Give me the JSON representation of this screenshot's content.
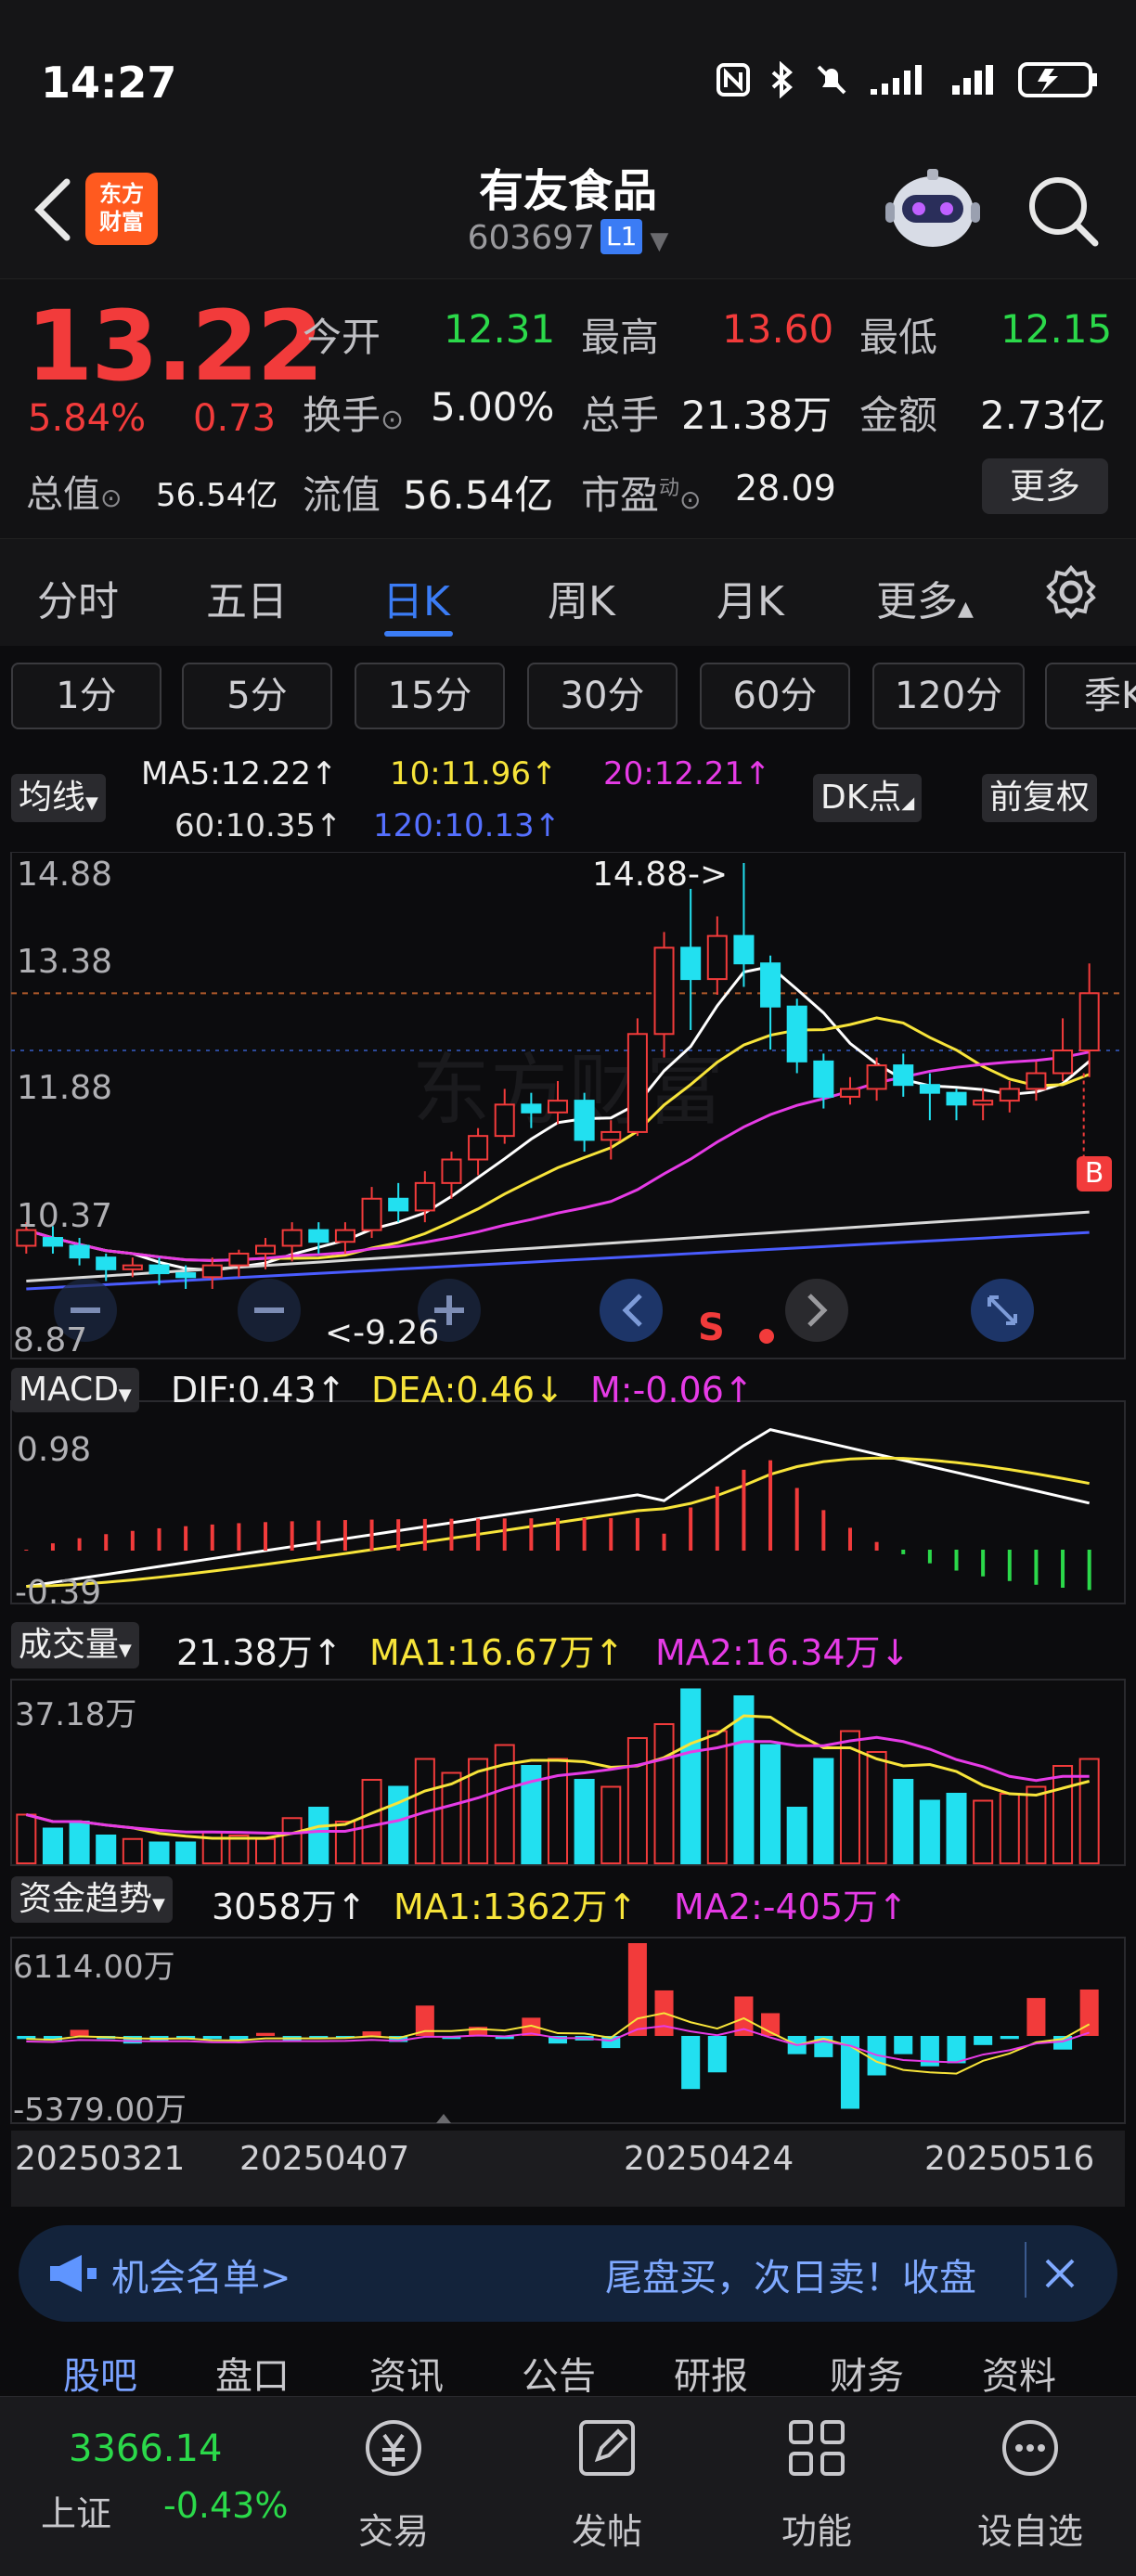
{
  "status": {
    "time": "14:27"
  },
  "header": {
    "name": "有友食品",
    "code": "603697",
    "badge": "L1",
    "logo_line1": "东方",
    "logo_line2": "财富"
  },
  "quote": {
    "price": "13.22",
    "pct": "5.84%",
    "chg": "0.73",
    "open_label": "今开",
    "open": "12.31",
    "high_label": "最高",
    "high": "13.60",
    "low_label": "最低",
    "low": "12.15",
    "turnover_label": "换手",
    "turnover": "5.00%",
    "volume_label": "总手",
    "volume": "21.38万",
    "amount_label": "金额",
    "amount": "2.73亿",
    "total_mv_label": "总值",
    "total_mv": "56.54亿",
    "float_mv_label": "流值",
    "float_mv": "56.54亿",
    "pe_label": "市盈",
    "pe_sup": "动",
    "pe": "28.09",
    "more": "更多"
  },
  "period_tabs": [
    "分时",
    "五日",
    "日K",
    "周K",
    "月K",
    "更多"
  ],
  "minute_buttons": [
    "1分",
    "5分",
    "15分",
    "30分",
    "60分",
    "120分",
    "季K"
  ],
  "ma_legend": {
    "selector": "均线",
    "ma5": "MA5:12.22↑",
    "ma10": "10:11.96↑",
    "ma20": "20:12.21↑",
    "ma60": "60:10.35↑",
    "ma120": "120:10.13↑",
    "dk": "DK点",
    "adjust": "前复权"
  },
  "kline_labels": {
    "y1": "14.88",
    "y2": "13.38",
    "y3": "11.88",
    "y4": "10.37",
    "y5": "8.87",
    "high_note": "14.88->",
    "low_note": "<-9.26",
    "sell_mark": "S",
    "buy_mark": "B"
  },
  "macd": {
    "selector": "MACD",
    "dif": "DIF:0.43↑",
    "dea": "DEA:0.46↓",
    "m": "M:-0.06↑",
    "y_top": "0.98",
    "y_bottom": "-0.39"
  },
  "vol": {
    "selector": "成交量",
    "value": "21.38万↑",
    "ma1": "MA1:16.67万↑",
    "ma2": "MA2:16.34万↓",
    "y_top": "37.18万"
  },
  "fund": {
    "selector": "资金趋势",
    "value": "3058万↑",
    "ma1": "MA1:1362万↑",
    "ma2": "MA2:-405万↑",
    "y_top": "6114.00万",
    "y_bottom": "-5379.00万"
  },
  "dates": [
    "20250321",
    "20250407",
    "20250424",
    "20250516"
  ],
  "notice": {
    "left": "机会名单>",
    "right": "尾盘买，次日卖！收盘"
  },
  "bottom_tabs": [
    "股吧",
    "盘口",
    "资讯",
    "公告",
    "研报",
    "财务",
    "资料"
  ],
  "index": {
    "value": "3366.14",
    "name": "上证",
    "chg": "-0.43%"
  },
  "nav": [
    "交易",
    "发帖",
    "功能",
    "设自选"
  ],
  "chart_data": {
    "type": "candlestick",
    "ylim": [
      8.87,
      14.88
    ],
    "candles": [
      {
        "o": 10.0,
        "c": 10.2,
        "h": 10.3,
        "l": 9.9
      },
      {
        "o": 10.1,
        "c": 10.0,
        "h": 10.25,
        "l": 9.9
      },
      {
        "o": 10.0,
        "c": 9.85,
        "h": 10.1,
        "l": 9.75
      },
      {
        "o": 9.85,
        "c": 9.7,
        "h": 9.9,
        "l": 9.55
      },
      {
        "o": 9.7,
        "c": 9.75,
        "h": 9.85,
        "l": 9.6
      },
      {
        "o": 9.75,
        "c": 9.65,
        "h": 9.85,
        "l": 9.5
      },
      {
        "o": 9.65,
        "c": 9.6,
        "h": 9.75,
        "l": 9.45
      },
      {
        "o": 9.6,
        "c": 9.75,
        "h": 9.85,
        "l": 9.45
      },
      {
        "o": 9.75,
        "c": 9.9,
        "h": 9.95,
        "l": 9.6
      },
      {
        "o": 9.9,
        "c": 10.0,
        "h": 10.1,
        "l": 9.7
      },
      {
        "o": 10.0,
        "c": 10.2,
        "h": 10.3,
        "l": 9.8
      },
      {
        "o": 10.2,
        "c": 10.05,
        "h": 10.3,
        "l": 9.9
      },
      {
        "o": 10.05,
        "c": 10.2,
        "h": 10.3,
        "l": 9.9
      },
      {
        "o": 10.2,
        "c": 10.6,
        "h": 10.75,
        "l": 10.1
      },
      {
        "o": 10.6,
        "c": 10.45,
        "h": 10.8,
        "l": 10.3
      },
      {
        "o": 10.45,
        "c": 10.8,
        "h": 10.95,
        "l": 10.3
      },
      {
        "o": 10.8,
        "c": 11.1,
        "h": 11.2,
        "l": 10.6
      },
      {
        "o": 11.1,
        "c": 11.4,
        "h": 11.5,
        "l": 10.9
      },
      {
        "o": 11.4,
        "c": 11.8,
        "h": 12.0,
        "l": 11.3
      },
      {
        "o": 11.8,
        "c": 11.7,
        "h": 11.95,
        "l": 11.5
      },
      {
        "o": 11.7,
        "c": 11.85,
        "h": 12.1,
        "l": 11.55
      },
      {
        "o": 11.85,
        "c": 11.35,
        "h": 11.95,
        "l": 11.2
      },
      {
        "o": 11.35,
        "c": 11.45,
        "h": 11.6,
        "l": 11.1
      },
      {
        "o": 11.45,
        "c": 12.7,
        "h": 12.9,
        "l": 11.4
      },
      {
        "o": 12.7,
        "c": 13.8,
        "h": 14.0,
        "l": 12.4
      },
      {
        "o": 13.8,
        "c": 13.4,
        "h": 14.55,
        "l": 12.75
      },
      {
        "o": 13.4,
        "c": 13.95,
        "h": 14.2,
        "l": 13.2
      },
      {
        "o": 13.95,
        "c": 13.6,
        "h": 14.88,
        "l": 13.3
      },
      {
        "o": 13.6,
        "c": 13.05,
        "h": 13.7,
        "l": 12.5
      },
      {
        "o": 13.05,
        "c": 12.35,
        "h": 13.15,
        "l": 12.2
      },
      {
        "o": 12.35,
        "c": 11.9,
        "h": 12.45,
        "l": 11.75
      },
      {
        "o": 11.9,
        "c": 12.0,
        "h": 12.15,
        "l": 11.8
      },
      {
        "o": 12.0,
        "c": 12.3,
        "h": 12.4,
        "l": 11.85
      },
      {
        "o": 12.3,
        "c": 12.05,
        "h": 12.45,
        "l": 11.9
      },
      {
        "o": 12.05,
        "c": 11.95,
        "h": 12.2,
        "l": 11.6
      },
      {
        "o": 11.95,
        "c": 11.8,
        "h": 12.0,
        "l": 11.6
      },
      {
        "o": 11.8,
        "c": 11.85,
        "h": 12.0,
        "l": 11.6
      },
      {
        "o": 11.85,
        "c": 12.0,
        "h": 12.1,
        "l": 11.7
      },
      {
        "o": 12.0,
        "c": 12.2,
        "h": 12.35,
        "l": 11.85
      },
      {
        "o": 12.2,
        "c": 12.49,
        "h": 12.9,
        "l": 12.1
      },
      {
        "o": 12.49,
        "c": 13.22,
        "h": 13.6,
        "l": 12.15
      }
    ]
  }
}
